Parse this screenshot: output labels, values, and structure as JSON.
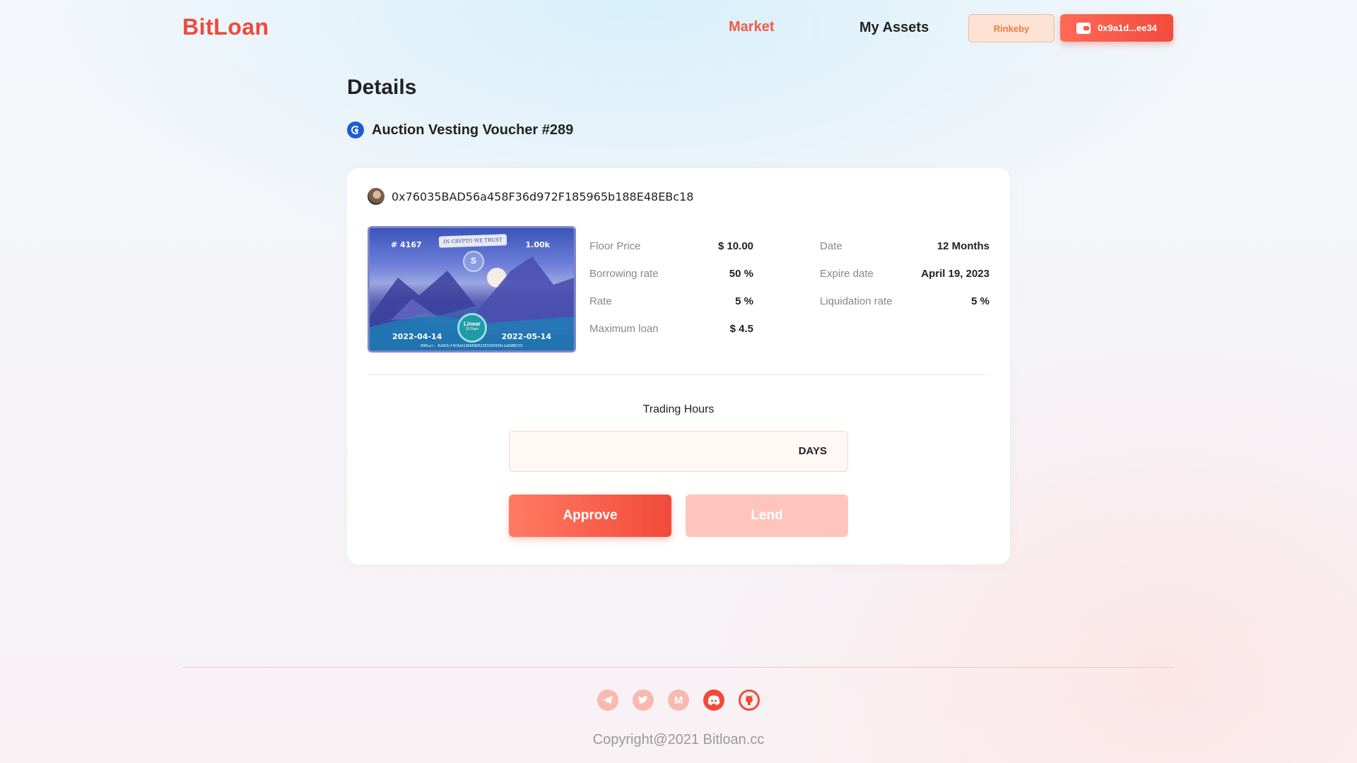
{
  "header": {
    "logo": "BitLoan",
    "nav": {
      "market": "Market",
      "my_assets": "My Assets"
    },
    "network": "Rinkeby",
    "wallet": "0x9a1d...ee34"
  },
  "details": {
    "title": "Details",
    "voucher_name": "Auction Vesting Voucher #289",
    "owner_address": "0x76035BAD56a458F36d972F185965b188E48EBc18"
  },
  "nft": {
    "id": "# 4167",
    "amount": "1.00k",
    "banner": "IN CRYPTO WE TRUST",
    "coin": "SOLV",
    "badge_title": "Linear",
    "badge_sub": "30 Days",
    "start": "2022-04-14",
    "end": "2022-05-14",
    "holder": "HODLer: 0xE63cf4C0dd1389E8D022E3393939c2a69BE215"
  },
  "info": {
    "floor_price_label": "Floor Price",
    "floor_price": "$ 10.00",
    "borrowing_rate_label": "Borrowing rate",
    "borrowing_rate": "50 %",
    "rate_label": "Rate",
    "rate": "5 %",
    "max_loan_label": "Maximum loan",
    "max_loan": "$ 4.5",
    "date_label": "Date",
    "date": "12 Months",
    "expire_label": "Expire date",
    "expire": "April 19, 2023",
    "liquidation_label": "Liquidation rate",
    "liquidation": "5 %"
  },
  "form": {
    "trading_hours_label": "Trading Hours",
    "days_value": "",
    "days_unit": "DAYS",
    "approve": "Approve",
    "lend": "Lend"
  },
  "footer": {
    "copyright": "Copyright@2021 Bitloan.cc",
    "icons": [
      "telegram-icon",
      "twitter-icon",
      "medium-icon",
      "discord-icon",
      "github-icon"
    ]
  },
  "colors": {
    "accent": "#f24a3a",
    "accent_light": "#ffc4bc",
    "network_bg": "#fde3d3"
  }
}
